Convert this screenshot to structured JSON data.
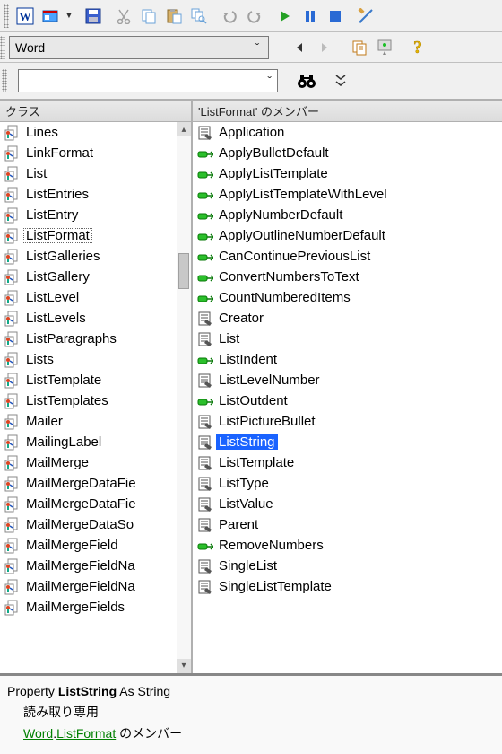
{
  "toolbar": {
    "library_combo": "Word",
    "search": ""
  },
  "panes": {
    "classes_header": "クラス",
    "members_header": "'ListFormat' のメンバー"
  },
  "classes": [
    "Lines",
    "LinkFormat",
    "List",
    "ListEntries",
    "ListEntry",
    "ListFormat",
    "ListGalleries",
    "ListGallery",
    "ListLevel",
    "ListLevels",
    "ListParagraphs",
    "Lists",
    "ListTemplate",
    "ListTemplates",
    "Mailer",
    "MailingLabel",
    "MailMerge",
    "MailMergeDataFie",
    "MailMergeDataFie",
    "MailMergeDataSo",
    "MailMergeField",
    "MailMergeFieldNa",
    "MailMergeFieldNa",
    "MailMergeFields"
  ],
  "classes_selected": "ListFormat",
  "members": [
    {
      "n": "Application",
      "k": "prop"
    },
    {
      "n": "ApplyBulletDefault",
      "k": "method"
    },
    {
      "n": "ApplyListTemplate",
      "k": "method"
    },
    {
      "n": "ApplyListTemplateWithLevel",
      "k": "method"
    },
    {
      "n": "ApplyNumberDefault",
      "k": "method"
    },
    {
      "n": "ApplyOutlineNumberDefault",
      "k": "method"
    },
    {
      "n": "CanContinuePreviousList",
      "k": "method"
    },
    {
      "n": "ConvertNumbersToText",
      "k": "method"
    },
    {
      "n": "CountNumberedItems",
      "k": "method"
    },
    {
      "n": "Creator",
      "k": "prop"
    },
    {
      "n": "List",
      "k": "prop"
    },
    {
      "n": "ListIndent",
      "k": "method"
    },
    {
      "n": "ListLevelNumber",
      "k": "prop"
    },
    {
      "n": "ListOutdent",
      "k": "method"
    },
    {
      "n": "ListPictureBullet",
      "k": "prop"
    },
    {
      "n": "ListString",
      "k": "prop"
    },
    {
      "n": "ListTemplate",
      "k": "prop"
    },
    {
      "n": "ListType",
      "k": "prop"
    },
    {
      "n": "ListValue",
      "k": "prop"
    },
    {
      "n": "Parent",
      "k": "prop"
    },
    {
      "n": "RemoveNumbers",
      "k": "method"
    },
    {
      "n": "SingleList",
      "k": "prop"
    },
    {
      "n": "SingleListTemplate",
      "k": "prop"
    }
  ],
  "members_selected": "ListString",
  "details": {
    "keyword_property": "Property",
    "name": "ListString",
    "keyword_as": "As",
    "type": "String",
    "readonly": "読み取り専用",
    "lib": "Word",
    "class": "ListFormat",
    "suffix": " のメンバー"
  }
}
